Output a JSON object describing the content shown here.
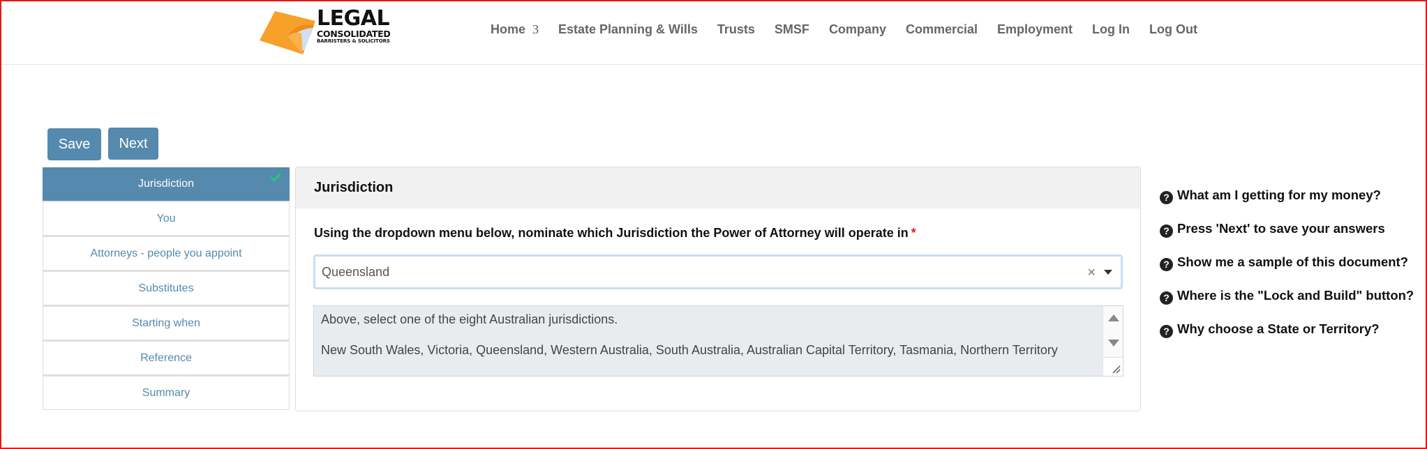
{
  "brand": {
    "name_line1": "LEGAL",
    "name_line2": "CONSOLIDATED",
    "tagline": "BARRISTERS & SOLICITORS",
    "logo_icon": "folded-page-icon",
    "accent_color": "#f7a12a"
  },
  "nav": {
    "items": [
      {
        "label": "Home",
        "badge": "3"
      },
      {
        "label": "Estate Planning & Wills"
      },
      {
        "label": "Trusts"
      },
      {
        "label": "SMSF"
      },
      {
        "label": "Company"
      },
      {
        "label": "Commercial"
      },
      {
        "label": "Employment"
      },
      {
        "label": "Log In"
      },
      {
        "label": "Log Out"
      }
    ]
  },
  "toolbar": {
    "save_label": "Save",
    "next_label": "Next",
    "button_color": "#5589ad"
  },
  "steps": {
    "items": [
      {
        "label": "Jurisdiction",
        "active": true,
        "completed": true
      },
      {
        "label": "You"
      },
      {
        "label": "Attorneys - people you appoint"
      },
      {
        "label": "Substitutes"
      },
      {
        "label": "Starting when"
      },
      {
        "label": "Reference"
      },
      {
        "label": "Summary"
      }
    ],
    "check_color": "#1ec97a"
  },
  "panel": {
    "title": "Jurisdiction",
    "question": "Using the dropdown menu below, nominate which Jurisdiction the Power of Attorney will operate in",
    "required_marker": "*",
    "select": {
      "value": "Queensland",
      "clear_icon": "×"
    },
    "help_text": {
      "line1": "Above, select one of the eight Australian jurisdictions.",
      "line2": "New South Wales, Victoria, Queensland, Western Australia, South Australia, Australian Capital Territory, Tasmania, Northern Territory"
    }
  },
  "faq": {
    "items": [
      {
        "label": "What am I getting for my money?"
      },
      {
        "label": "Press 'Next' to save your answers"
      },
      {
        "label": "Show me a sample of this document?"
      },
      {
        "label": "Where is the \"Lock and Build\" button?"
      },
      {
        "label": "Why choose a State or Territory?"
      }
    ]
  }
}
